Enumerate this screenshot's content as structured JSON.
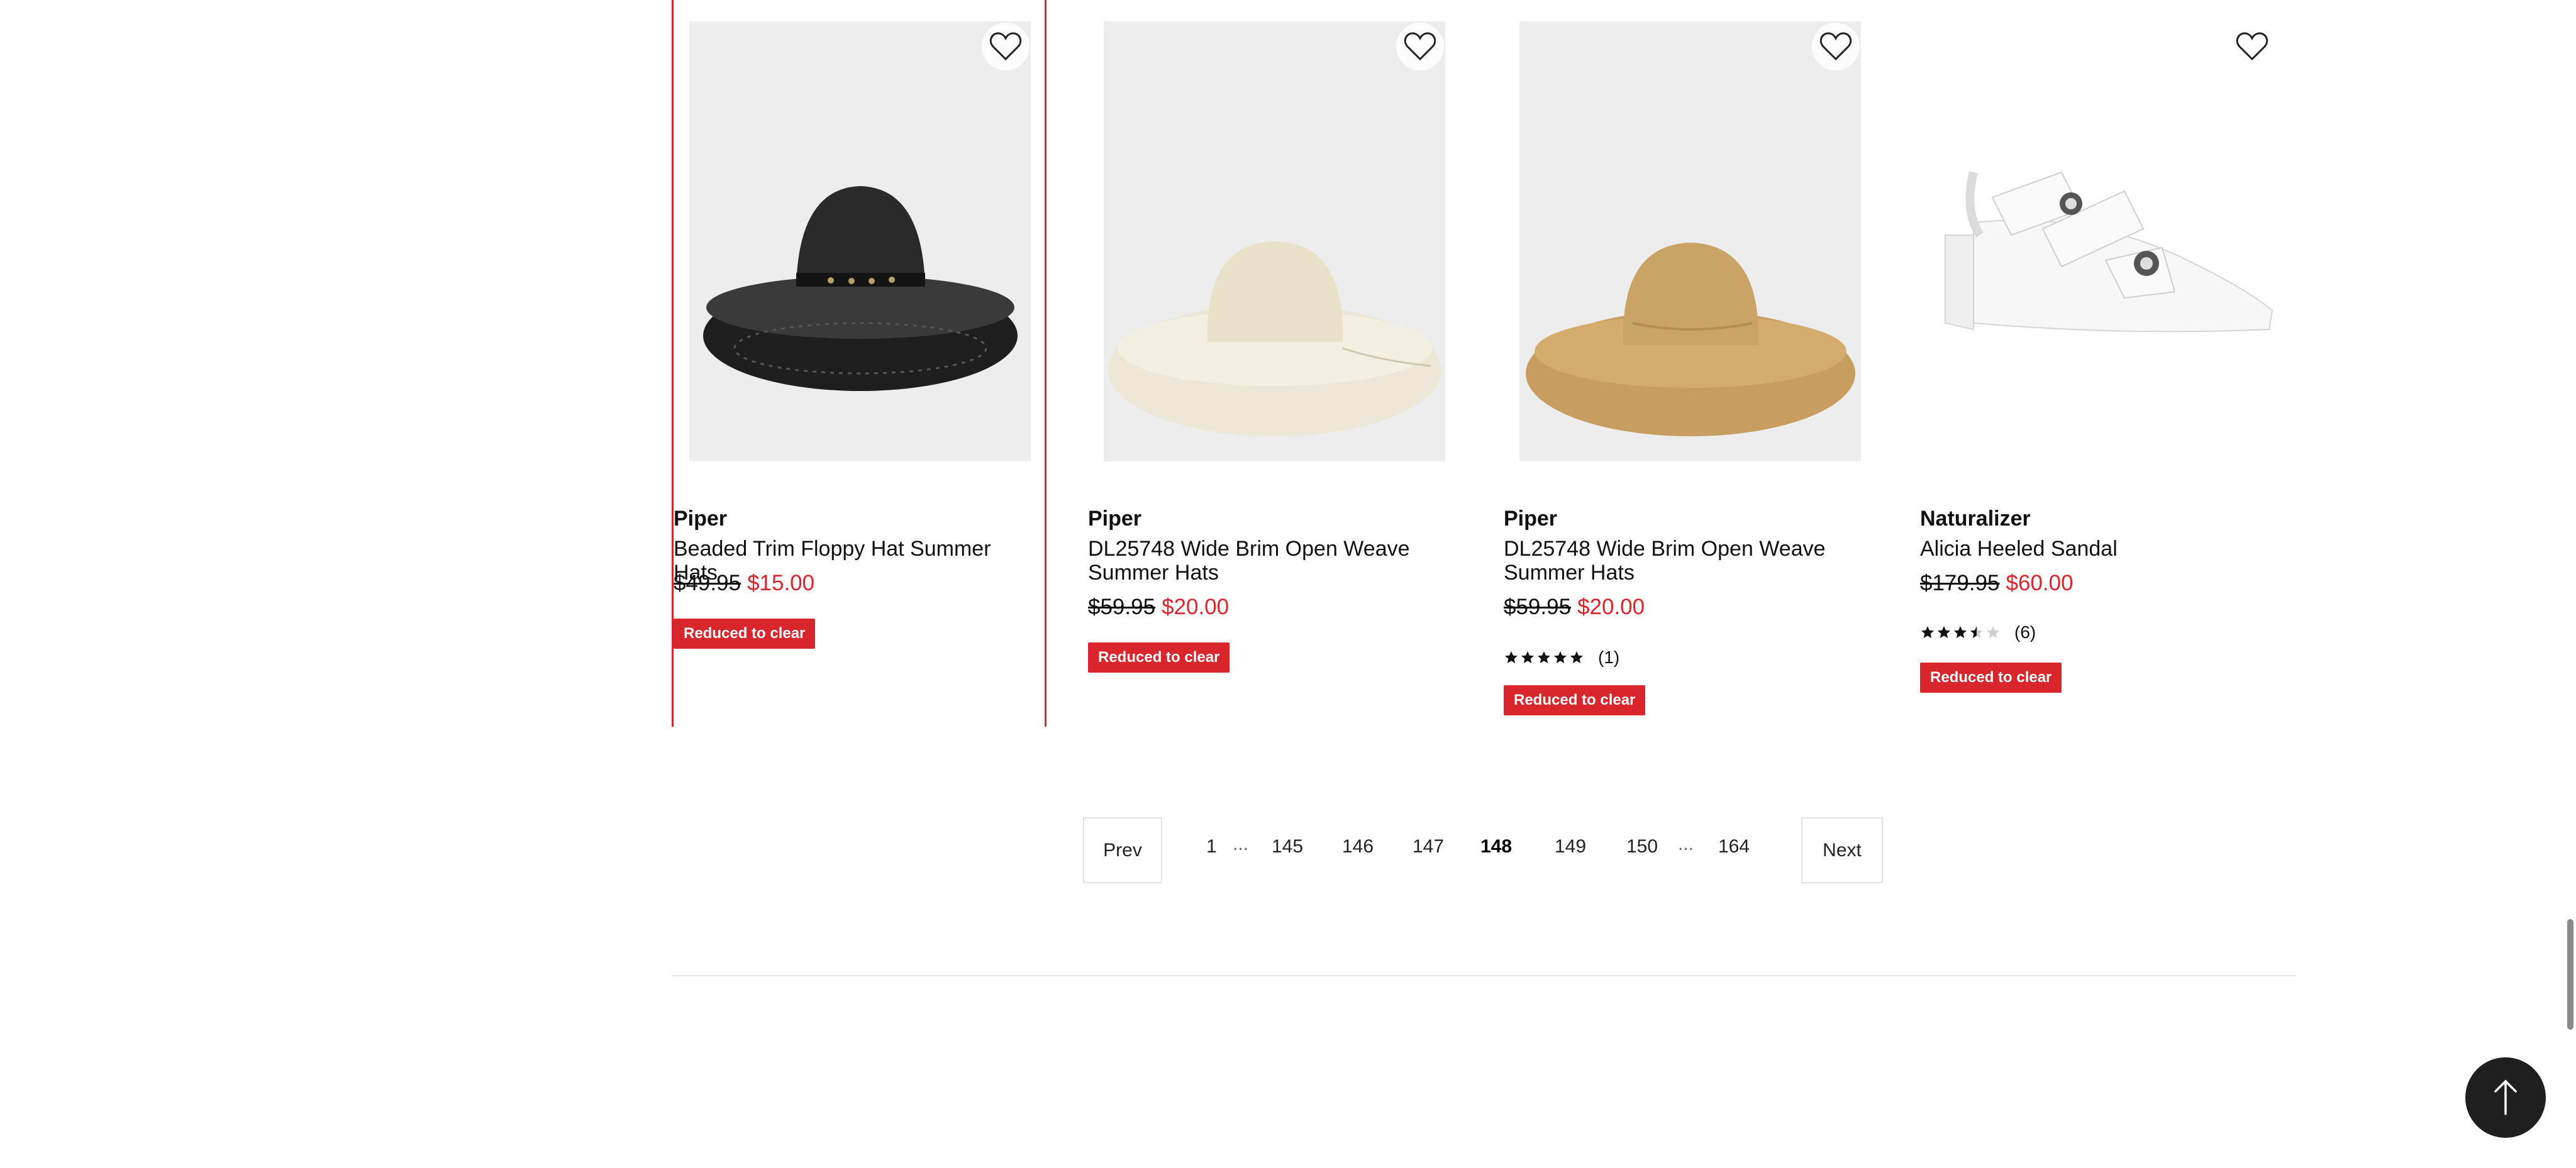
{
  "products": [
    {
      "brand": "Piper",
      "name": "Beaded Trim Floppy Hat Summer Hats",
      "original_price": "$49.95",
      "sale_price": "$15.00",
      "badge": "Reduced to clear",
      "image": "black-floppy-hat"
    },
    {
      "brand": "Piper",
      "name": "DL25748 Wide Brim Open Weave Summer Hats",
      "original_price": "$59.95",
      "sale_price": "$20.00",
      "badge": "Reduced to clear",
      "image": "cream-wide-brim-hat"
    },
    {
      "brand": "Piper",
      "name": "DL25748 Wide Brim Open Weave Summer Hats",
      "original_price": "$59.95",
      "sale_price": "$20.00",
      "rating": 5,
      "review_count": "(1)",
      "badge": "Reduced to clear",
      "image": "tan-wide-brim-hat"
    },
    {
      "brand": "Naturalizer",
      "name": "Alicia Heeled Sandal",
      "original_price": "$179.95",
      "sale_price": "$60.00",
      "rating": 3.5,
      "review_count": "(6)",
      "badge": "Reduced to clear",
      "image": "white-heeled-sandal"
    }
  ],
  "pagination": {
    "prev_label": "Prev",
    "next_label": "Next",
    "pages": [
      "1",
      "145",
      "146",
      "147",
      "148",
      "149",
      "150",
      "164"
    ],
    "ellipsis": "...",
    "current": "148"
  },
  "icons": {
    "wishlist": "heart-outline-icon",
    "back_to_top": "arrow-up-icon",
    "star": "star-icon"
  },
  "colors": {
    "sale": "#d9252c",
    "badge_bg": "#d9252c",
    "selected_border": "#d9252c",
    "back_to_top_bg": "#1f1f1f"
  }
}
